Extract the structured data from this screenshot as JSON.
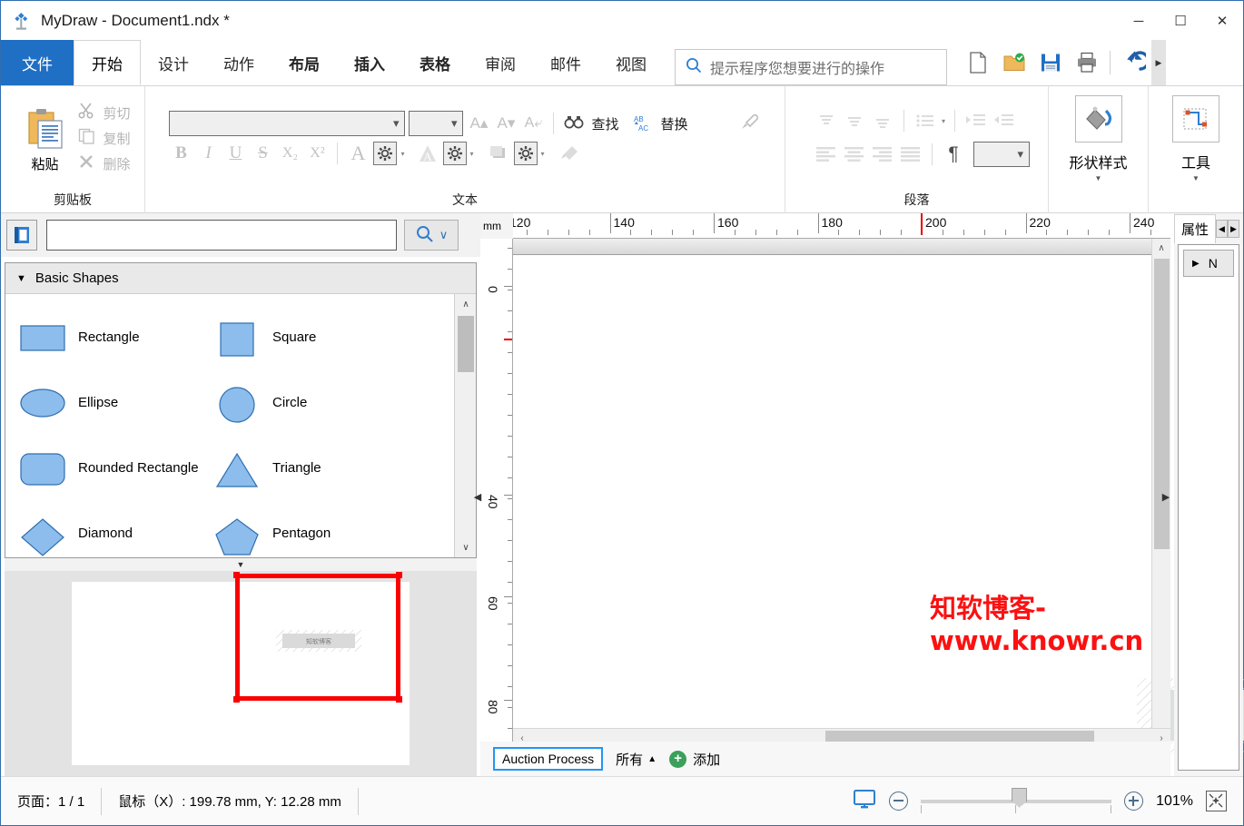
{
  "window": {
    "title": "MyDraw - Document1.ndx *",
    "logo_icon": "mydraw-logo-icon",
    "minimize": "─",
    "maximize": "☐",
    "close": "✕"
  },
  "ribbon": {
    "file_tab": "文件",
    "tabs": [
      {
        "label": "开始",
        "active": true
      },
      {
        "label": "设计",
        "active": false
      },
      {
        "label": "动作",
        "active": false
      },
      {
        "label": "布局",
        "active": false
      },
      {
        "label": "插入",
        "active": false
      },
      {
        "label": "表格",
        "active": false
      },
      {
        "label": "审阅",
        "active": false
      },
      {
        "label": "邮件",
        "active": false
      },
      {
        "label": "视图",
        "active": false
      }
    ],
    "tell_me_placeholder": "提示程序您想要进行的操作",
    "quick_access": [
      {
        "name": "new-document-icon"
      },
      {
        "name": "open-folder-icon"
      },
      {
        "name": "save-icon"
      },
      {
        "name": "print-icon"
      },
      {
        "name": "undo-icon"
      }
    ],
    "more_arrow": "▶",
    "groups": {
      "clipboard": {
        "label": "剪贴板",
        "paste": "粘贴",
        "cut": "剪切",
        "copy": "复制",
        "delete": "删除"
      },
      "text": {
        "label": "文本",
        "font_value": "",
        "size_value": "",
        "find": "查找",
        "replace": "替换",
        "bold": "B",
        "italic": "I",
        "underline": "U",
        "strike": "S",
        "subscript": "X₂",
        "superscript": "X²"
      },
      "paragraph": {
        "label": "段落",
        "pilcrow": "¶",
        "spacing_value": ""
      },
      "shape_styles": {
        "label": "形状样式",
        "dropdown": "▼"
      },
      "tools": {
        "label": "工具",
        "dropdown": "▼"
      }
    }
  },
  "shapes_panel": {
    "book_icon": "shape-library-icon",
    "search_value": "",
    "search_icon": "search-icon",
    "search_dropdown": "∨",
    "category": "Basic Shapes",
    "collapse_glyph": "▼",
    "scroll_up": "∧",
    "scroll_down": "∨",
    "splitter_glyph": "▼",
    "items": [
      {
        "label": "Rectangle",
        "shape": "rectangle"
      },
      {
        "label": "Square",
        "shape": "square"
      },
      {
        "label": "Ellipse",
        "shape": "ellipse"
      },
      {
        "label": "Circle",
        "shape": "circle"
      },
      {
        "label": "Rounded Rectangle",
        "shape": "rounded-rectangle"
      },
      {
        "label": "Triangle",
        "shape": "triangle"
      },
      {
        "label": "Diamond",
        "shape": "diamond"
      },
      {
        "label": "Pentagon",
        "shape": "pentagon"
      }
    ],
    "shape_fill": "#8cbdec",
    "shape_stroke": "#2f6fb0"
  },
  "canvas": {
    "unit_label": "mm",
    "h_ticks": [
      "120",
      "140",
      "160",
      "180",
      "200",
      "220",
      "240"
    ],
    "v_ticks": [
      "0",
      "40",
      "60",
      "80"
    ],
    "mouse_marker_mm": 200,
    "watermark": "知软博客-www.knowr.cn",
    "watermark_color": "#fb1111",
    "shape_text": "知软博客",
    "scroll_left": "‹",
    "scroll_right": "›",
    "scroll_up": "∧",
    "scroll_down": "∨",
    "pane_left_arrow": "◀",
    "pane_right_arrow": "▶"
  },
  "page_tabs": {
    "current": "Auction Process",
    "all_label": "所有",
    "all_caret": "▲",
    "add_label": "添加",
    "add_glyph": "+"
  },
  "properties": {
    "tab_label": "属性",
    "nav_prev": "◀",
    "nav_next": "▶",
    "tree_item": "N",
    "tree_expander": "▶"
  },
  "status": {
    "page_label": "页面：1 / 1",
    "mouse_label": "鼠标（X）: 199.78 mm, Y: 12.28 mm",
    "zoom_percent": "101%",
    "monitor_icon": "display-icon",
    "zoom_out": "−",
    "zoom_in": "+",
    "fit_icon": "fit-page-icon"
  },
  "colors": {
    "accent": "#1f6fc4",
    "selection_red": "#fb0000",
    "watermark_red": "#fb1111",
    "tab_blue": "#2196f3",
    "add_green": "#3aa05a"
  }
}
